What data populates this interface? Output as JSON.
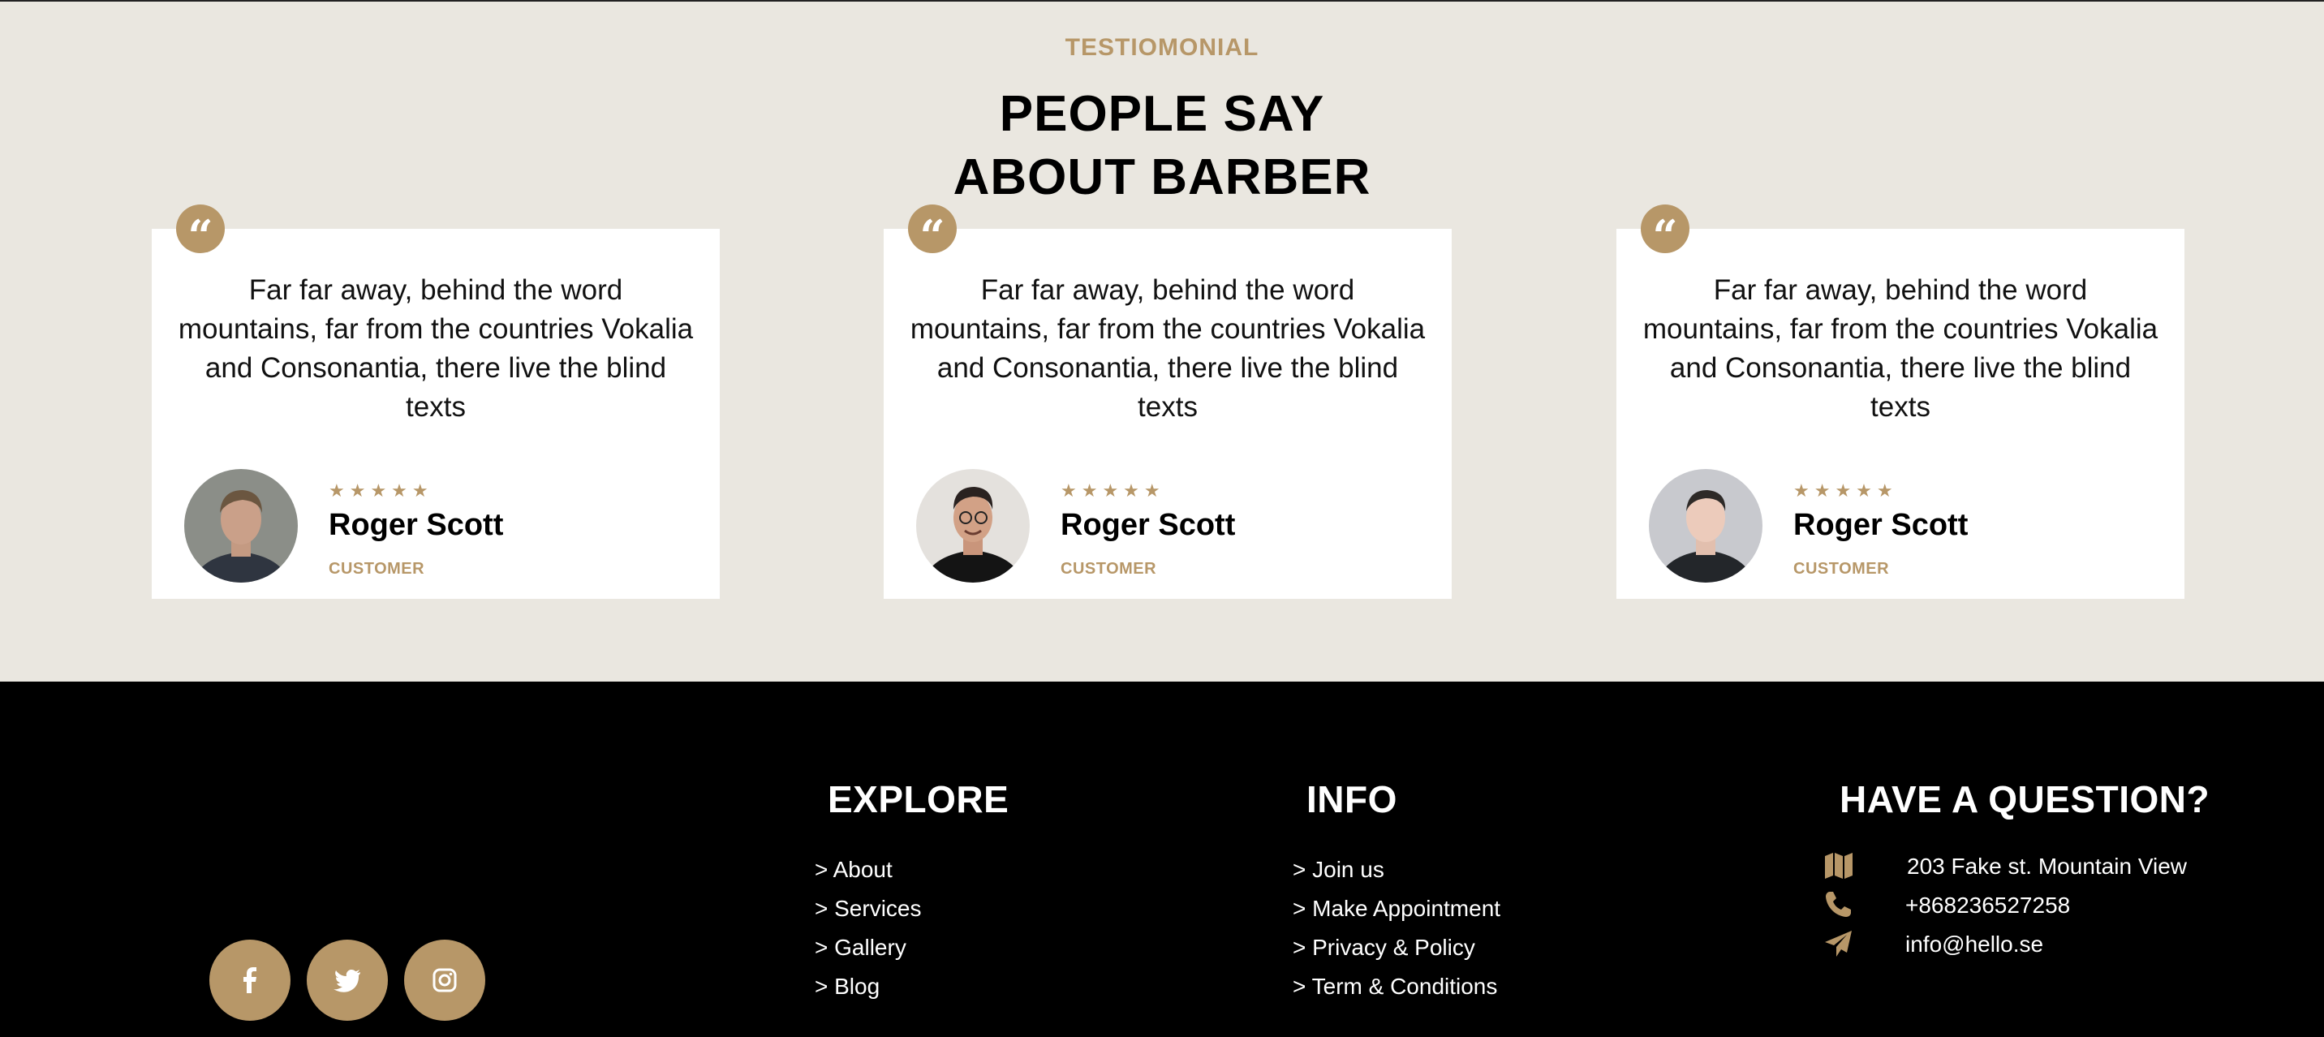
{
  "testimonials": {
    "eyebrow": "TESTIOMONIAL",
    "title_line1": "PEOPLE SAY",
    "title_line2": "ABOUT BARBER",
    "stars": "★★★★★",
    "cards": [
      {
        "quote_mark": "“",
        "text": "Far far away, behind the word mountains, far from the countries Vokalia and Consonantia, there live the blind texts",
        "name": "Roger Scott",
        "role": "CUSTOMER"
      },
      {
        "quote_mark": "“",
        "text": "Far far away, behind the word mountains, far from the countries Vokalia and Consonantia, there live the blind texts",
        "name": "Roger Scott",
        "role": "CUSTOMER"
      },
      {
        "quote_mark": "“",
        "text": "Far far away, behind the word mountains, far from the countries Vokalia and Consonantia, there live the blind texts",
        "name": "Roger Scott",
        "role": "CUSTOMER"
      }
    ]
  },
  "footer": {
    "explore": {
      "heading": "EXPLORE",
      "links": [
        "> About",
        "> Services",
        "> Gallery",
        "> Blog"
      ]
    },
    "info": {
      "heading": "INFO",
      "links": [
        "> Join us",
        "> Make Appointment",
        "> Privacy & Policy",
        "> Term & Conditions"
      ]
    },
    "contact": {
      "heading": "HAVE A QUESTION?",
      "address": "203 Fake st. Mountain View",
      "phone": "+868236527258",
      "email": "info@hello.se"
    },
    "social": [
      "facebook-icon",
      "twitter-icon",
      "instagram-icon"
    ]
  },
  "colors": {
    "accent": "#b79768",
    "section_bg": "#eae7e0",
    "footer_bg": "#000000"
  }
}
